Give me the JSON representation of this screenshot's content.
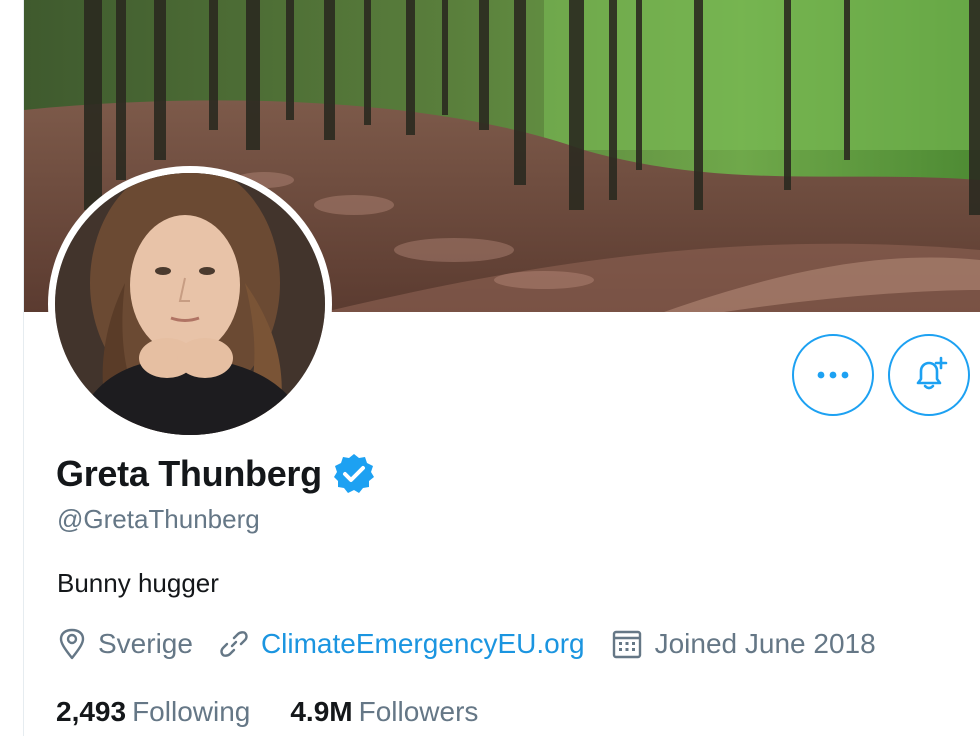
{
  "profile": {
    "name": "Greta Thunberg",
    "handle": "@GretaThunberg",
    "bio": "Bunny hugger",
    "location": "Sverige",
    "website": "ClimateEmergencyEU.org",
    "joined": "Joined June 2018",
    "following_count": "2,493",
    "following_label": "Following",
    "followers_count": "4.9M",
    "followers_label": "Followers",
    "verified": true
  },
  "icons": {
    "more": "more-dots-icon",
    "notify": "bell-plus-icon",
    "verified": "verified-badge-icon",
    "location": "location-pin-icon",
    "link": "link-icon",
    "calendar": "calendar-icon"
  },
  "colors": {
    "accent": "#1da1f2",
    "link": "#1b95e0",
    "text_primary": "#14171a",
    "text_secondary": "#657786"
  }
}
